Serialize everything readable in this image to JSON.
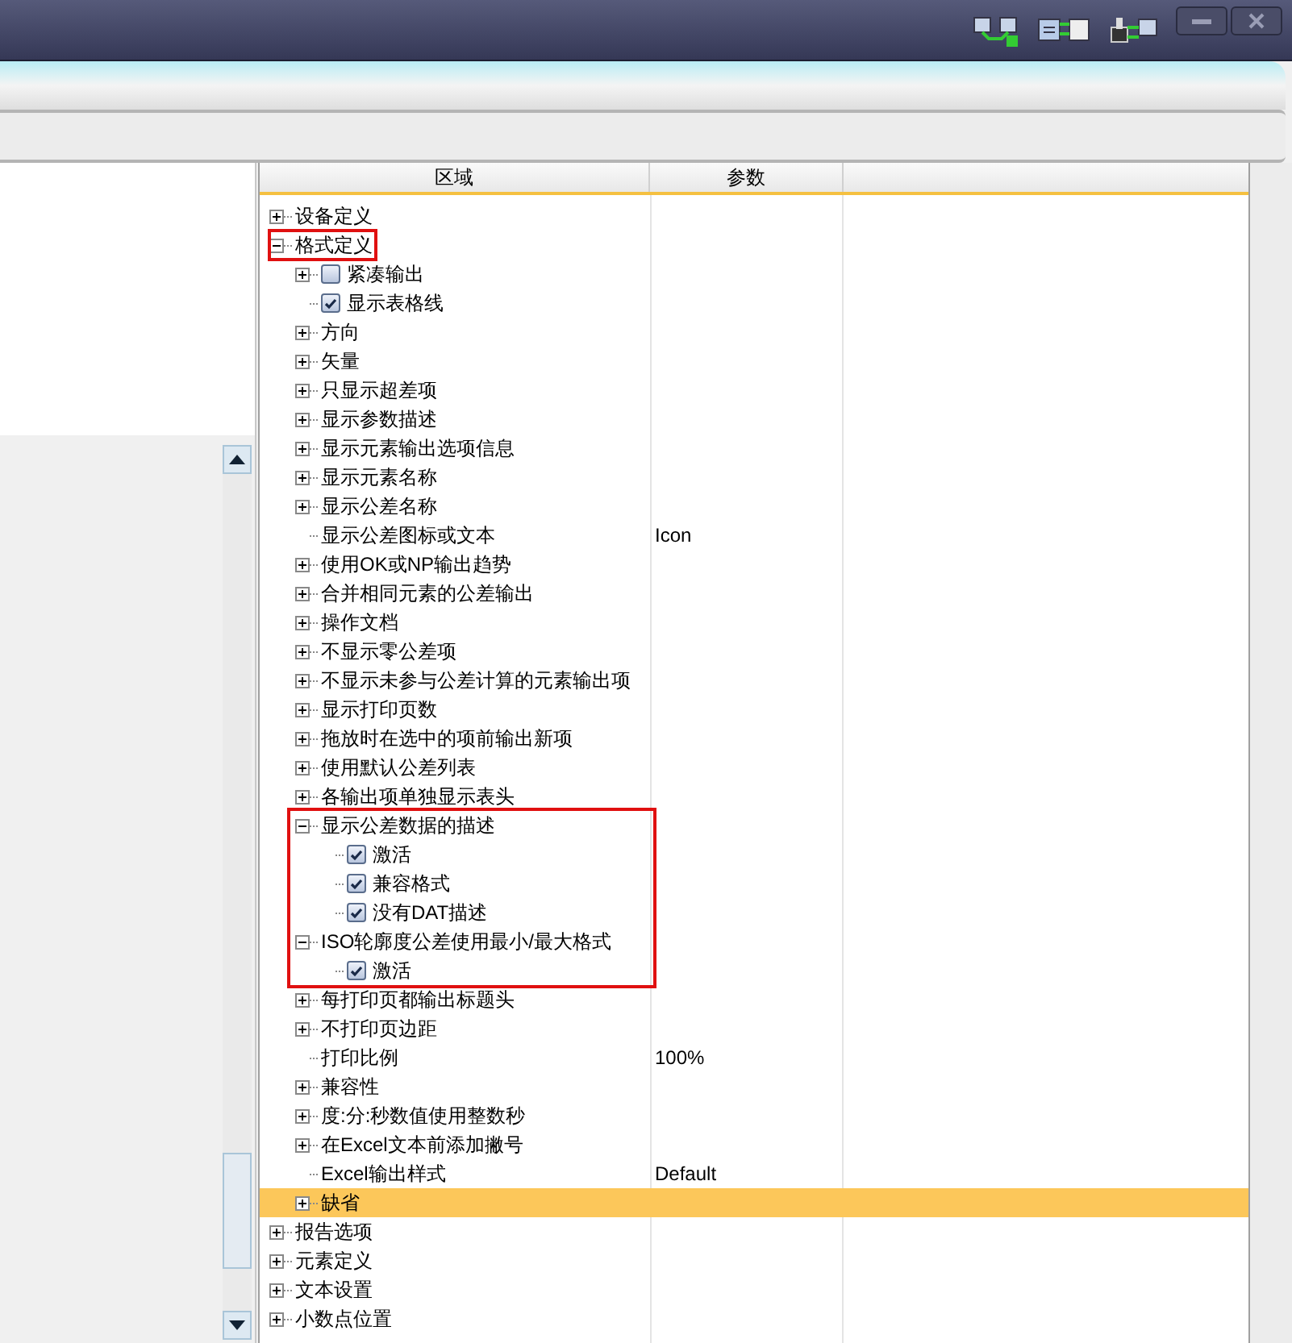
{
  "columns": [
    "区域",
    "参数"
  ],
  "tree": [
    {
      "label": "设备定义",
      "kind": "group",
      "expanded": false,
      "selected": false
    },
    {
      "label": "格式定义",
      "kind": "group",
      "expanded": true,
      "selected": false,
      "label_framed": true,
      "children": [
        {
          "label": "紧凑输出",
          "kind": "checkbox",
          "expanded": false,
          "checked": false,
          "selected": false
        },
        {
          "label": "显示表格线",
          "kind": "checkbox",
          "checked": true,
          "selected": false
        },
        {
          "label": "方向",
          "kind": "group",
          "expanded": false,
          "selected": false
        },
        {
          "label": "矢量",
          "kind": "group",
          "expanded": false,
          "selected": false
        },
        {
          "label": "只显示超差项",
          "kind": "group",
          "expanded": false,
          "selected": false
        },
        {
          "label": "显示参数描述",
          "kind": "group",
          "expanded": false,
          "selected": false
        },
        {
          "label": "显示元素输出选项信息",
          "kind": "group",
          "expanded": false,
          "selected": false
        },
        {
          "label": "显示元素名称",
          "kind": "group",
          "expanded": false,
          "selected": false
        },
        {
          "label": "显示公差名称",
          "kind": "group",
          "expanded": false,
          "selected": false
        },
        {
          "label": "显示公差图标或文本",
          "kind": "leaf",
          "value": "Icon",
          "selected": false
        },
        {
          "label": "使用OK或NP输出趋势",
          "kind": "group",
          "expanded": false,
          "selected": false
        },
        {
          "label": "合并相同元素的公差输出",
          "kind": "group",
          "expanded": false,
          "selected": false
        },
        {
          "label": "操作文档",
          "kind": "group",
          "expanded": false,
          "selected": false
        },
        {
          "label": "不显示零公差项",
          "kind": "group",
          "expanded": false,
          "selected": false
        },
        {
          "label": "不显示未参与公差计算的元素输出项",
          "kind": "group",
          "expanded": false,
          "selected": false
        },
        {
          "label": "显示打印页数",
          "kind": "group",
          "expanded": false,
          "selected": false
        },
        {
          "label": "拖放时在选中的项前输出新项",
          "kind": "group",
          "expanded": false,
          "selected": false
        },
        {
          "label": "使用默认公差列表",
          "kind": "group",
          "expanded": false,
          "selected": false
        },
        {
          "label": "各输出项单独显示表头",
          "kind": "group",
          "expanded": false,
          "selected": false
        },
        {
          "label": "显示公差数据的描述",
          "kind": "group",
          "expanded": true,
          "selected": false,
          "framed": true,
          "children": [
            {
              "label": "激活",
              "kind": "checkbox",
              "checked": true,
              "selected": false
            },
            {
              "label": "兼容格式",
              "kind": "checkbox",
              "checked": true,
              "selected": false
            },
            {
              "label": "没有DAT描述",
              "kind": "checkbox",
              "checked": true,
              "selected": false
            }
          ]
        },
        {
          "label": "ISO轮廓度公差使用最小/最大格式",
          "kind": "group",
          "expanded": true,
          "selected": false,
          "framed": true,
          "children": [
            {
              "label": "激活",
              "kind": "checkbox",
              "checked": true,
              "selected": false
            }
          ]
        },
        {
          "label": "每打印页都输出标题头",
          "kind": "group",
          "expanded": false,
          "selected": false
        },
        {
          "label": "不打印页边距",
          "kind": "group",
          "expanded": false,
          "selected": false
        },
        {
          "label": "打印比例",
          "kind": "leaf",
          "value": "100%",
          "selected": false
        },
        {
          "label": "兼容性",
          "kind": "group",
          "expanded": false,
          "selected": false
        },
        {
          "label": "度:分:秒数值使用整数秒",
          "kind": "group",
          "expanded": false,
          "selected": false
        },
        {
          "label": "在Excel文本前添加撇号",
          "kind": "group",
          "expanded": false,
          "selected": false
        },
        {
          "label": "Excel输出样式",
          "kind": "leaf",
          "value": "Default",
          "selected": false
        },
        {
          "label": "缺省",
          "kind": "group",
          "expanded": false,
          "selected": true
        }
      ]
    },
    {
      "label": "报告选项",
      "kind": "group",
      "expanded": false,
      "selected": false
    },
    {
      "label": "元素定义",
      "kind": "group",
      "expanded": false,
      "selected": false
    },
    {
      "label": "文本设置",
      "kind": "group",
      "expanded": false,
      "selected": false
    },
    {
      "label": "小数点位置",
      "kind": "group",
      "expanded": false,
      "selected": false
    }
  ]
}
